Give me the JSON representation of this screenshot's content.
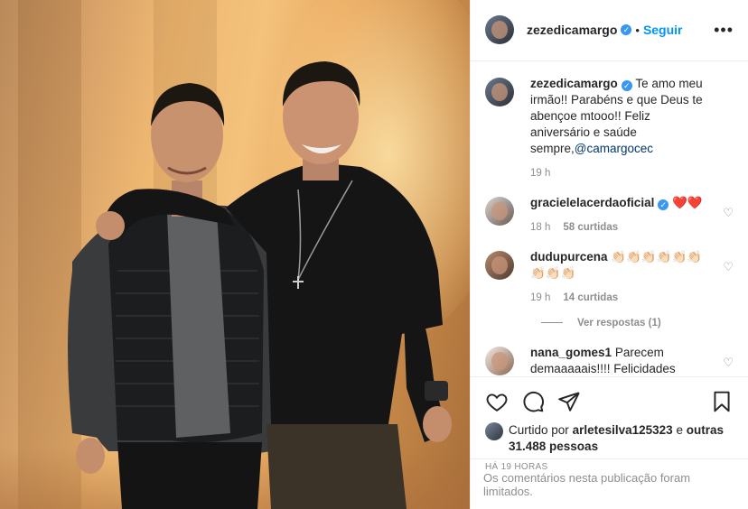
{
  "header": {
    "username": "zezedicamargo",
    "separator": "•",
    "follow_label": "Seguir",
    "more_icon": "more-horizontal-icon"
  },
  "caption": {
    "username": "zezedicamargo",
    "text": "Te amo meu irmão!! Parabéns e que Deus te abençoe mtooo!! Feliz aniversário e saúde sempre,",
    "mention": "@camargocec",
    "time": "19 h"
  },
  "comments": [
    {
      "username": "gracielelacerdaoficial",
      "text": "❤️❤️",
      "time": "18 h",
      "likes": "58 curtidas"
    },
    {
      "username": "dudupurcena",
      "text": "👏🏻👏🏻👏🏻👏🏻👏🏻👏🏻👏🏻👏🏻👏🏻",
      "time": "19 h",
      "likes": "14 curtidas",
      "replies": "Ver respostas (1)"
    },
    {
      "username": "nana_gomes1",
      "text": "Parecem demaaaaais!!!! Felicidades"
    }
  ],
  "likes": {
    "prefix": "Curtido por",
    "user": "arletesilva125323",
    "connector": "e",
    "others": "outras 31.488 pessoas"
  },
  "posted": "HÁ 19 HORAS",
  "comments_limited": "Os comentários nesta publicação foram limitados.",
  "colors": {
    "link": "#0095f6",
    "verified": "#3897f0",
    "muted": "#8e8e8e",
    "heart": "#ed4956"
  }
}
